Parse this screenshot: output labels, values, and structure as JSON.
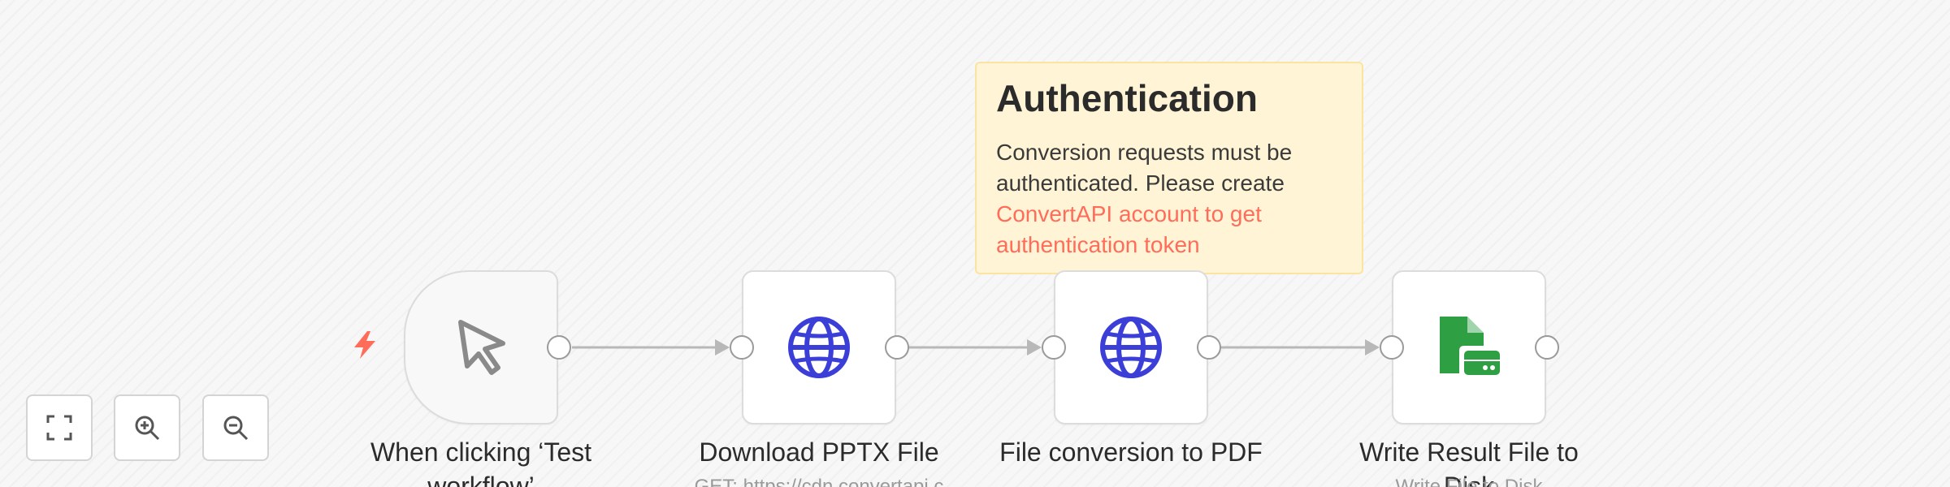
{
  "sticky_note": {
    "title": "Authentication",
    "body_text": "Conversion requests must be authenticated. Please create ",
    "link_text": "ConvertAPI account to get authentication token"
  },
  "nodes": [
    {
      "label": "When clicking ‘Test workflow’",
      "subtitle": "",
      "icon": "pointer-cursor-icon"
    },
    {
      "label": "Download PPTX File",
      "subtitle": "GET: https://cdn.convertapi.c",
      "icon": "globe-icon"
    },
    {
      "label": "File conversion to PDF",
      "subtitle": "",
      "icon": "globe-icon"
    },
    {
      "label": "Write Result File to Disk",
      "subtitle": "Write File to Disk",
      "icon": "file-disk-icon"
    }
  ],
  "colors": {
    "accent": "#ff6d5a",
    "globe": "#3b3fd8",
    "disk": "#2ea043",
    "sticky_bg": "#fff5d6",
    "wire": "#b8b8b8"
  },
  "controls": {
    "fit_view": "fit-view-icon",
    "zoom_in": "zoom-in-icon",
    "zoom_out": "zoom-out-icon"
  }
}
